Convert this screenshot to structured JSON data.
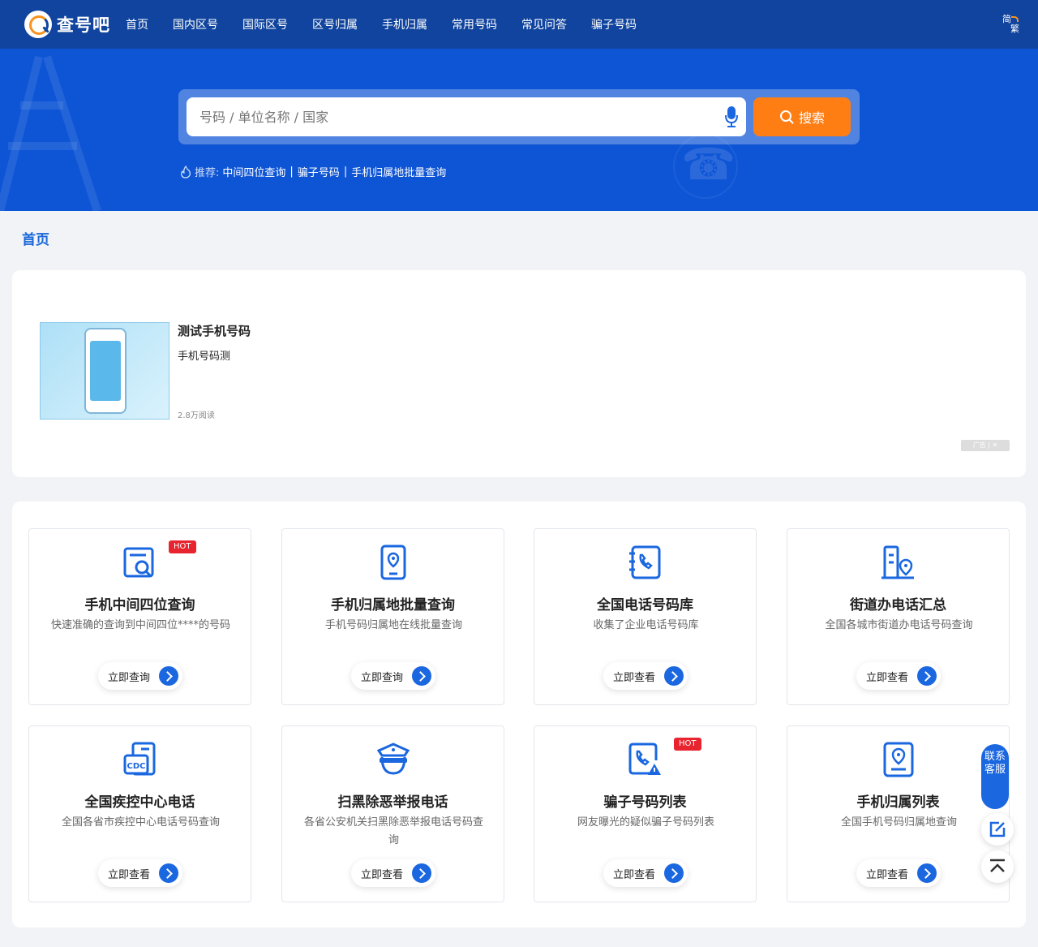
{
  "header": {
    "logo_text": "查号吧",
    "nav": [
      "首页",
      "国内区号",
      "国际区号",
      "区号归属",
      "手机归属",
      "常用号码",
      "常见问答",
      "骗子号码"
    ],
    "lang_top": "简",
    "lang_bottom": "繁"
  },
  "search": {
    "placeholder": "号码 / 单位名称 / 国家",
    "button_label": "搜索"
  },
  "recommend": {
    "label": "推荐:",
    "links": [
      "中间四位查询",
      "骗子号码",
      "手机归属地批量查询"
    ],
    "separator": "|"
  },
  "breadcrumb": "首页",
  "ad": {
    "title": "测试手机号码",
    "subtitle": "手机号码测",
    "reads": "2.8万阅读",
    "mark": "广告 | ✕"
  },
  "services": [
    {
      "title": "手机中间四位查询",
      "desc": "快速准确的查询到中间四位****的号码",
      "button": "立即查询",
      "badge": "HOT",
      "icon": "search-doc-icon"
    },
    {
      "title": "手机归属地批量查询",
      "desc": "手机号码归属地在线批量查询",
      "button": "立即查询",
      "badge": "",
      "icon": "phone-location-icon"
    },
    {
      "title": "全国电话号码库",
      "desc": "收集了企业电话号码库",
      "button": "立即查看",
      "badge": "",
      "icon": "phonebook-icon"
    },
    {
      "title": "街道办电话汇总",
      "desc": "全国各城市街道办电话号码查询",
      "button": "立即查看",
      "badge": "",
      "icon": "building-location-icon"
    },
    {
      "title": "全国疾控中心电话",
      "desc": "全国各省市疾控中心电话号码查询",
      "button": "立即查看",
      "badge": "",
      "icon": "cdc-icon"
    },
    {
      "title": "扫黑除恶举报电话",
      "desc": "各省公安机关扫黑除恶举报电话号码查询",
      "button": "立即查看",
      "badge": "",
      "icon": "police-icon"
    },
    {
      "title": "骗子号码列表",
      "desc": "网友曝光的疑似骗子号码列表",
      "button": "立即查看",
      "badge": "HOT",
      "icon": "phone-warning-icon"
    },
    {
      "title": "手机归属列表",
      "desc": "全国手机号码归属地查询",
      "button": "立即查看",
      "badge": "",
      "icon": "location-card-icon"
    }
  ],
  "float": {
    "contact": "联系客服"
  },
  "colors": {
    "header": "#10449e",
    "hero": "#0e55d6",
    "accent": "#1a67e0",
    "search_button": "#ff7e14",
    "hot": "#e8242f"
  }
}
